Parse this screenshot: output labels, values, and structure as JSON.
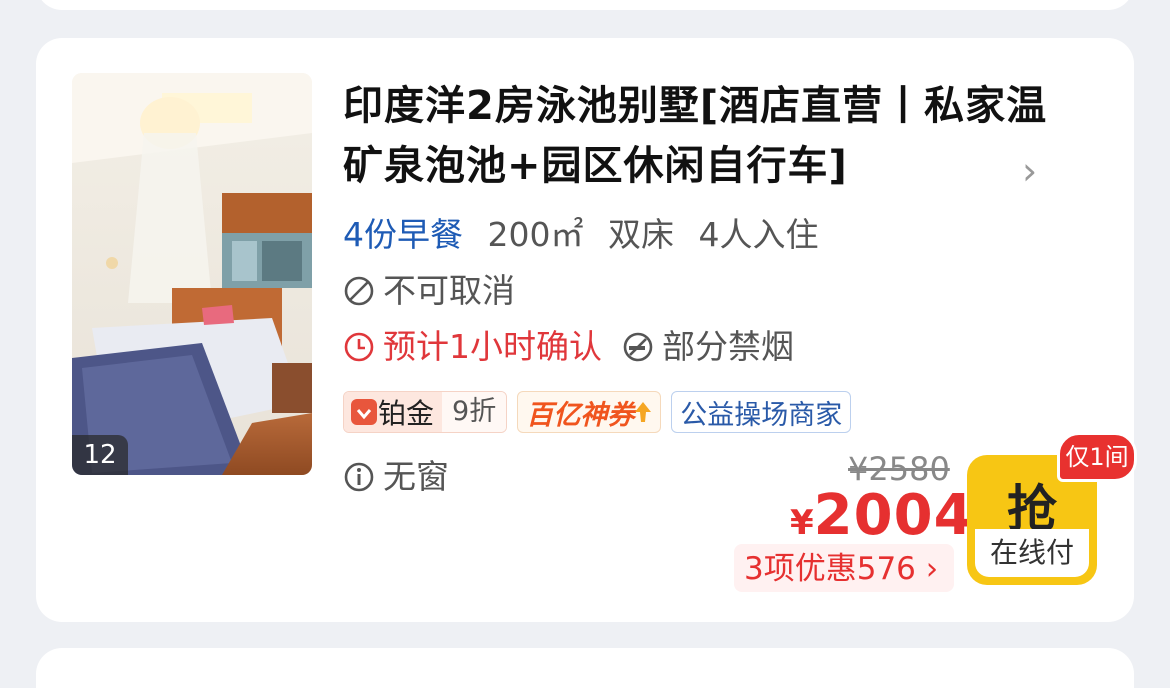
{
  "hotel_room": {
    "photo_count": "12",
    "title": "印度洋2房泳池别墅[酒店直营丨私家温矿泉泡池+园区休闲自行车]",
    "breakfast": "4份早餐",
    "area": "200㎡",
    "bed": "双床",
    "occupancy": "4人入住",
    "cancel_policy": "不可取消",
    "confirm_time": "预计1小时确认",
    "smoking": "部分禁烟",
    "window": "无窗",
    "tags": {
      "platinum_label": "铂金",
      "platinum_discount": "9折",
      "coupon": "百亿神券",
      "charity": "公益操场商家"
    },
    "original_price": "¥2580",
    "currency": "¥",
    "price": "2004",
    "discount_text": "3项优惠576",
    "buy_label": "抢",
    "pay_label": "在线付",
    "stock_badge": "仅1间"
  },
  "icons": {
    "photo": "bedroom-photo",
    "title_arrow": "chevron-right-icon",
    "cancel": "ban-icon",
    "confirm": "clock-icon",
    "smoking": "no-smoking-icon",
    "window": "info-icon",
    "platinum": "heart-badge-icon",
    "coupon": "arrow-up-icon"
  },
  "colors": {
    "accent_red": "#e63030",
    "breakfast_blue": "#1e5bb5",
    "buy_yellow": "#f7c614"
  }
}
